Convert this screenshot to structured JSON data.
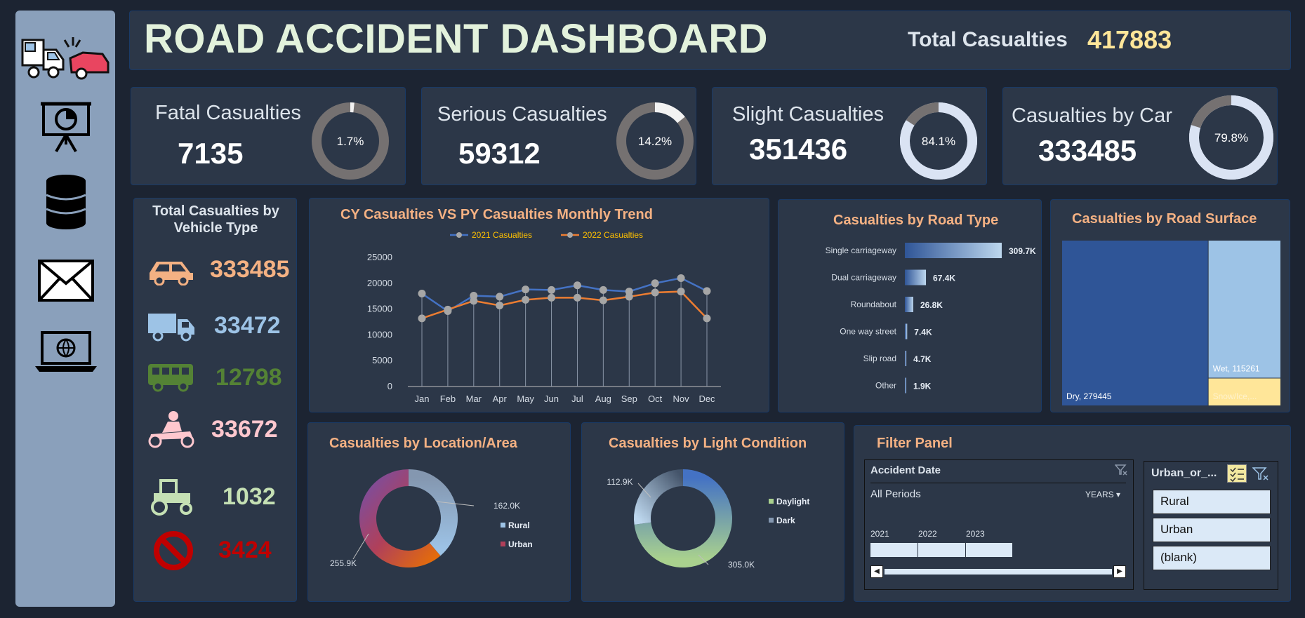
{
  "header": {
    "title": "ROAD ACCIDENT DASHBOARD",
    "total_label": "Total Casualties",
    "total_value": "417883"
  },
  "kpis": [
    {
      "label": "Fatal Casualties",
      "value": "7135",
      "pct_text": "1.7%",
      "pct": 0.017
    },
    {
      "label": "Serious Casualties",
      "value": "59312",
      "pct_text": "14.2%",
      "pct": 0.142
    },
    {
      "label": "Slight Casualties",
      "value": "351436",
      "pct_text": "84.1%",
      "pct": 0.841
    },
    {
      "label": "Casualties by Car",
      "value": "333485",
      "pct_text": "79.8%",
      "pct": 0.798
    }
  ],
  "sidebar": {
    "icons": [
      "car-crash-icon",
      "presentation-icon",
      "database-icon",
      "mail-icon",
      "laptop-globe-icon"
    ]
  },
  "vehicle": {
    "title": "Total Casualties by Vehicle Type",
    "items": [
      {
        "icon": "car-icon",
        "value": "333485",
        "color": "#f4b183"
      },
      {
        "icon": "truck-icon",
        "value": "33472",
        "color": "#9dc3e6"
      },
      {
        "icon": "bus-icon",
        "value": "12798",
        "color": "#548235"
      },
      {
        "icon": "motorcycle-icon",
        "value": "33672",
        "color": "#ffc7ce"
      },
      {
        "icon": "tractor-icon",
        "value": "1032",
        "color": "#c5e0b4"
      },
      {
        "icon": "no-entry-icon",
        "value": "3424",
        "color": "#c00000"
      }
    ]
  },
  "trend": {
    "title": "CY Casualties VS PY Casualties Monthly Trend",
    "chart_data": {
      "type": "line",
      "categories": [
        "Jan",
        "Feb",
        "Mar",
        "Apr",
        "May",
        "Jun",
        "Jul",
        "Aug",
        "Sep",
        "Oct",
        "Nov",
        "Dec"
      ],
      "ylim": [
        0,
        25000
      ],
      "yticks": [
        "0",
        "5000",
        "10000",
        "15000",
        "20000",
        "25000"
      ],
      "series": [
        {
          "name": "2021 Casualties",
          "color": "#4472c4",
          "values": [
            18000,
            14600,
            17600,
            17400,
            18800,
            18700,
            19600,
            18700,
            18400,
            20000,
            21000,
            18500
          ]
        },
        {
          "name": "2022 Casualties",
          "color": "#ed7d31",
          "values": [
            13200,
            14900,
            16600,
            15700,
            16800,
            17200,
            17200,
            16700,
            17400,
            18200,
            18400,
            13200
          ]
        }
      ]
    }
  },
  "road_type": {
    "title": "Casualties by Road Type",
    "chart_data": {
      "type": "bar",
      "categories": [
        "Single carriageway",
        "Dual carriageway",
        "Roundabout",
        "One way street",
        "Slip road",
        "Other"
      ],
      "values": [
        309700,
        67400,
        26800,
        7400,
        4700,
        1900
      ],
      "labels": [
        "309.7K",
        "67.4K",
        "26.8K",
        "7.4K",
        "4.7K",
        "1.9K"
      ]
    }
  },
  "surface": {
    "title": "Casualties by Road Surface",
    "chart_data": {
      "type": "treemap",
      "items": [
        {
          "label": "Dry, 279445",
          "value": 279445,
          "color": "#2f5597"
        },
        {
          "label": "Wet, 115261",
          "value": 115261,
          "color": "#9dc3e6"
        },
        {
          "label": "Snow/Ice,...",
          "value": 23177,
          "color": "#ffe699"
        }
      ]
    }
  },
  "location": {
    "title": "Casualties by Location/Area",
    "chart_data": {
      "type": "pie",
      "categories": [
        "Rural",
        "Urban"
      ],
      "values": [
        162000,
        255900
      ],
      "labels": [
        "162.0K",
        "255.9K"
      ],
      "legend": [
        "Rural",
        "Urban"
      ]
    }
  },
  "light": {
    "title": "Casualties by Light Condition",
    "chart_data": {
      "type": "pie",
      "categories": [
        "Daylight",
        "Dark"
      ],
      "values": [
        305000,
        112900
      ],
      "labels": [
        "305.0K",
        "112.9K"
      ],
      "legend": [
        "Daylight",
        "Dark"
      ]
    }
  },
  "filter": {
    "title": "Filter Panel",
    "date_title": "Accident Date",
    "period": "All Periods",
    "unit": "YEARS",
    "years": [
      "2021",
      "2022",
      "2023"
    ],
    "urban_title": "Urban_or_...",
    "urban_items": [
      "Rural",
      "Urban",
      "(blank)"
    ]
  }
}
